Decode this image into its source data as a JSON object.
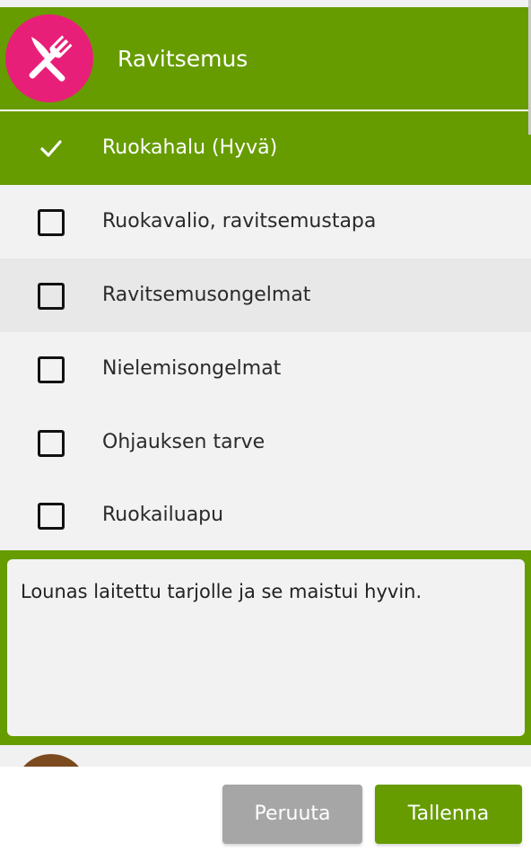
{
  "header": {
    "title": "Ravitsemus",
    "icon": "fork-knife-icon",
    "icon_bg_color": "#e81f78",
    "bg_color": "#669c00"
  },
  "options": [
    {
      "label": "Ruokahalu (Hyvä)",
      "checked": true
    },
    {
      "label": "Ruokavalio, ravitsemustapa",
      "checked": false
    },
    {
      "label": "Ravitsemusongelmat",
      "checked": false
    },
    {
      "label": "Nielemisongelmat",
      "checked": false
    },
    {
      "label": "Ohjauksen tarve",
      "checked": false
    },
    {
      "label": "Ruokailuapu",
      "checked": false
    }
  ],
  "notes": {
    "value": "Lounas laitettu tarjolle ja se maistui hyvin."
  },
  "footer": {
    "cancel_label": "Peruuta",
    "save_label": "Tallenna"
  },
  "colors": {
    "accent": "#669c00",
    "cancel": "#a6a6a6"
  }
}
